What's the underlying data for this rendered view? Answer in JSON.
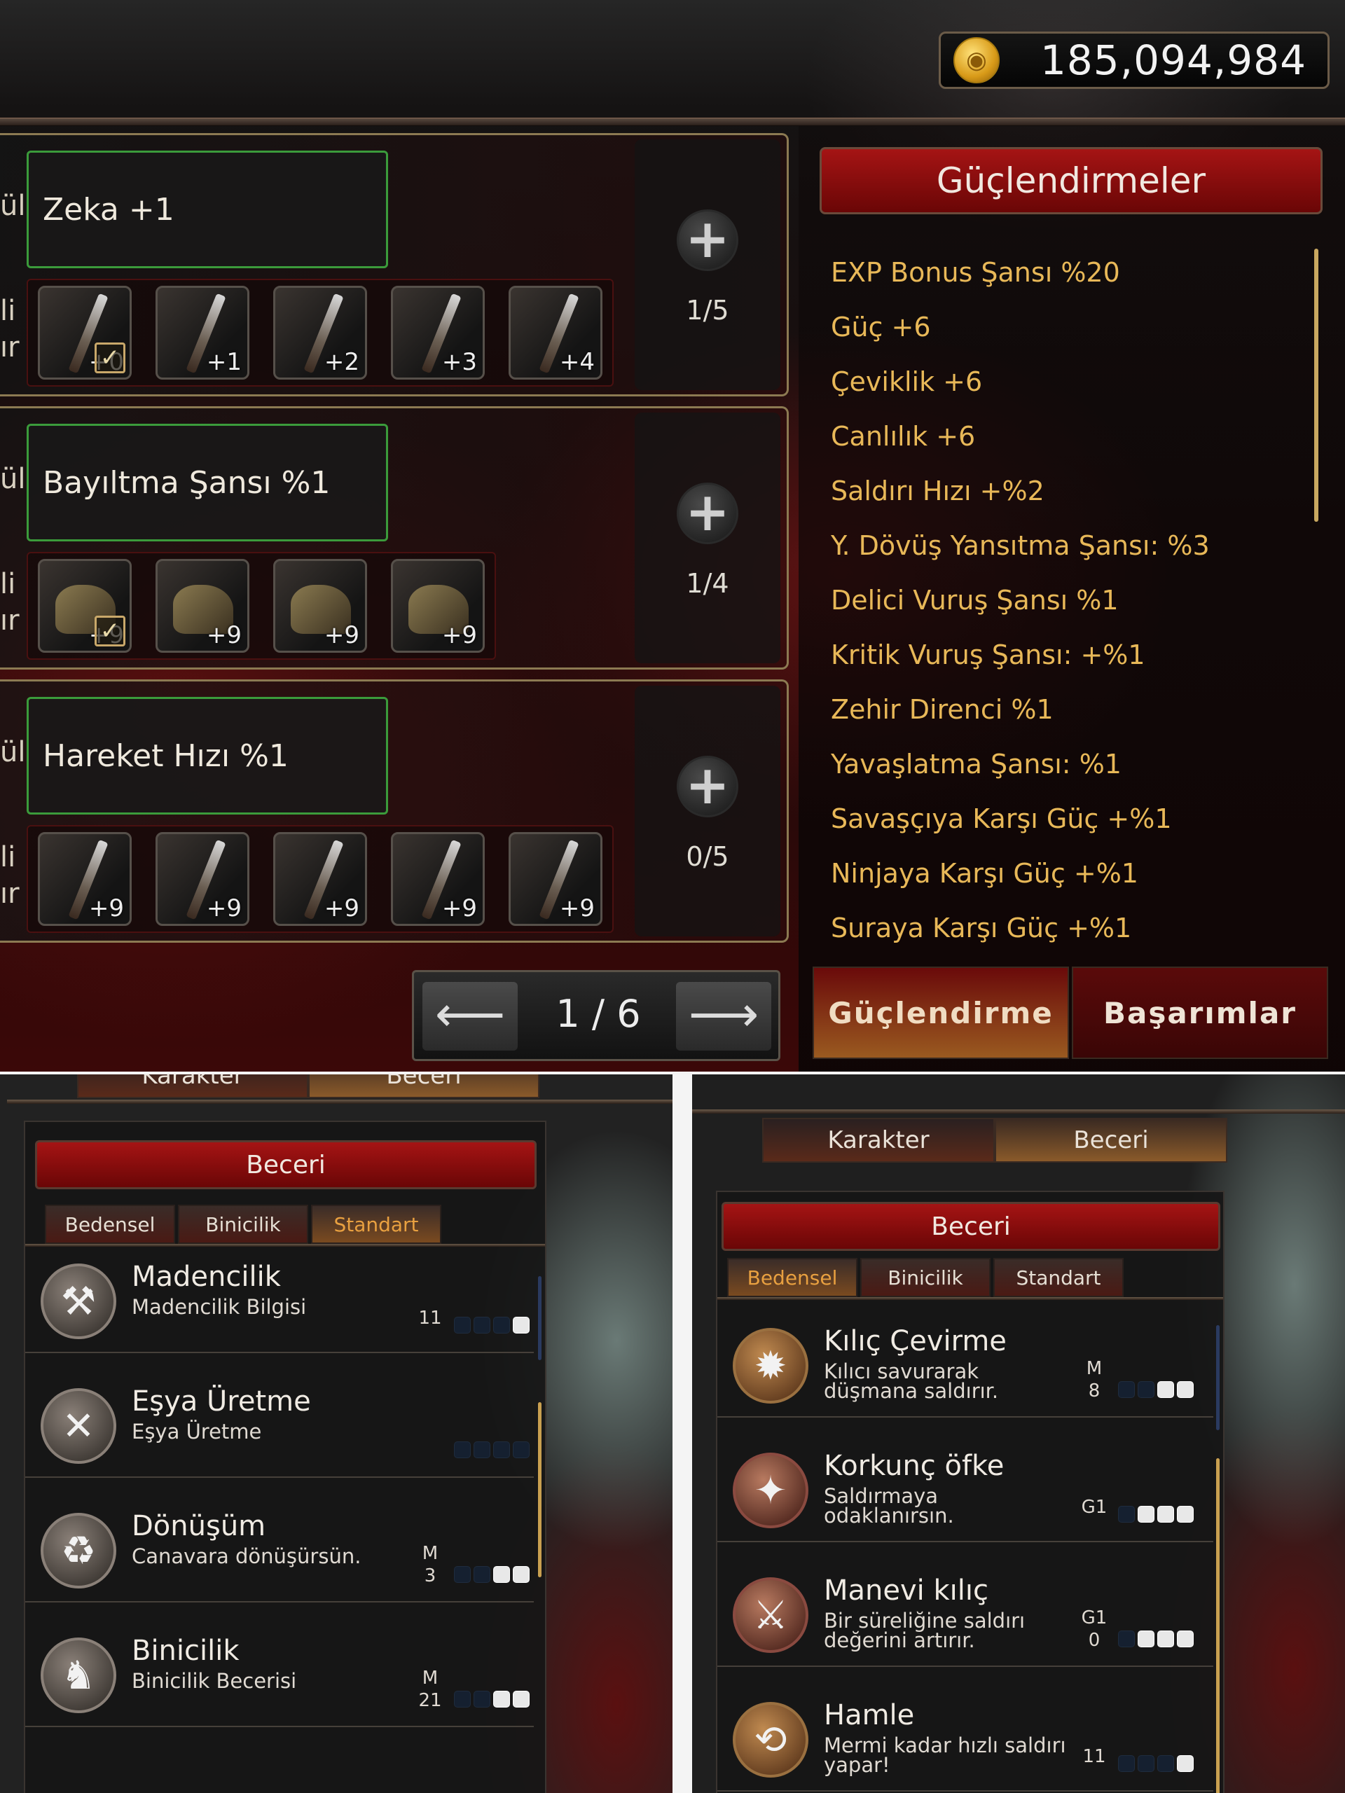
{
  "gold": {
    "icon": "gold-coin-icon",
    "amount": "185,094,984"
  },
  "slots": [
    {
      "edge_top": "ül",
      "edge_mid": "li",
      "edge_bot": "ır",
      "bonus": "Zeka +1",
      "count": "1/5",
      "items": [
        {
          "kind": "weapon",
          "label": "+0",
          "checked": true
        },
        {
          "kind": "weapon",
          "label": "+1"
        },
        {
          "kind": "weapon",
          "label": "+2"
        },
        {
          "kind": "weapon",
          "label": "+3"
        },
        {
          "kind": "weapon",
          "label": "+4"
        }
      ]
    },
    {
      "edge_top": "ül",
      "edge_mid": "li",
      "edge_bot": "ır",
      "bonus": "Bayıltma Şansı %1",
      "count": "1/4",
      "items": [
        {
          "kind": "boots",
          "label": "+9",
          "checked": true
        },
        {
          "kind": "boots",
          "label": "+9"
        },
        {
          "kind": "boots",
          "label": "+9"
        },
        {
          "kind": "boots",
          "label": "+9"
        }
      ]
    },
    {
      "edge_top": "ül",
      "edge_mid": "li",
      "edge_bot": "ır",
      "bonus": "Hareket Hızı %1",
      "count": "0/5",
      "items": [
        {
          "kind": "weapon",
          "label": "+9"
        },
        {
          "kind": "weapon",
          "label": "+9"
        },
        {
          "kind": "weapon",
          "label": "+9"
        },
        {
          "kind": "weapon",
          "label": "+9"
        },
        {
          "kind": "weapon",
          "label": "+9"
        }
      ]
    }
  ],
  "pager": {
    "prev_icon": "arrow-left-icon",
    "next_icon": "arrow-right-icon",
    "text": "1 / 6"
  },
  "buffs": {
    "title": "Güçlendirmeler",
    "items": [
      "EXP Bonus Şansı %20",
      "Güç +6",
      "Çeviklik +6",
      "Canlılık +6",
      "Saldırı Hızı +%2",
      "Y. Dövüş Yansıtma Şansı: %3",
      "Delici Vuruş Şansı %1",
      "Kritik Vuruş Şansı: +%1",
      "Zehir Direnci %1",
      "Yavaşlatma Şansı: %1",
      "Savaşçıya Karşı Güç +%1",
      "Ninjaya Karşı Güç +%1",
      "Suraya Karşı Güç +%1"
    ],
    "tabs": [
      "Güçlendirme",
      "Başarımlar"
    ],
    "active_tab": 0
  },
  "left_panel": {
    "top_tabs": [
      "Karakter",
      "Beceri"
    ],
    "title": "Beceri",
    "sub_tabs": [
      "Bedensel",
      "Binicilik",
      "Standart"
    ],
    "active_sub_tab": 2,
    "skills": [
      {
        "name": "Madencilik",
        "desc": "Madencilik Bilgisi",
        "grade": "11",
        "pips": 1,
        "icon": "pickaxe-icon",
        "glyph": "⚒"
      },
      {
        "name": "Eşya Üretme",
        "desc": "Eşya Üretme",
        "grade": "",
        "pips": 0,
        "icon": "crossed-tools-icon",
        "glyph": "✕"
      },
      {
        "name": "Dönüşüm",
        "desc": "Canavara dönüşürsün.",
        "grade": "M\n3",
        "pips": 2,
        "icon": "transform-icon",
        "glyph": "♻"
      },
      {
        "name": "Binicilik",
        "desc": "Binicilik Becerisi",
        "grade": "M\n21",
        "pips": 2,
        "icon": "horse-icon",
        "glyph": "♞"
      }
    ]
  },
  "right_panel": {
    "top_tabs": [
      "Karakter",
      "Beceri"
    ],
    "title": "Beceri",
    "sub_tabs": [
      "Bedensel",
      "Binicilik",
      "Standart"
    ],
    "active_sub_tab": 0,
    "skills": [
      {
        "name": "Kılıç Çevirme",
        "desc": "Kılıcı savurarak\ndüşmana saldırır.",
        "grade": "M\n8",
        "pips": 2,
        "icon": "sword-spin-icon",
        "glyph": "✹",
        "tone": "brown"
      },
      {
        "name": "Korkunç öfke",
        "desc": "Saldırmaya\nodaklanırsın.",
        "grade": "G1",
        "pips": 3,
        "icon": "rage-icon",
        "glyph": "✦",
        "tone": "red"
      },
      {
        "name": "Manevi kılıç",
        "desc": "Bir süreliğine saldırı\ndeğerini artırır.",
        "grade": "G1\n0",
        "pips": 3,
        "icon": "spirit-sword-icon",
        "glyph": "⚔",
        "tone": "red"
      },
      {
        "name": "Hamle",
        "desc": "Mermi kadar hızlı saldırı\nyapar!",
        "grade": "11",
        "pips": 1,
        "icon": "dash-icon",
        "glyph": "⟲",
        "tone": "brown"
      }
    ]
  }
}
